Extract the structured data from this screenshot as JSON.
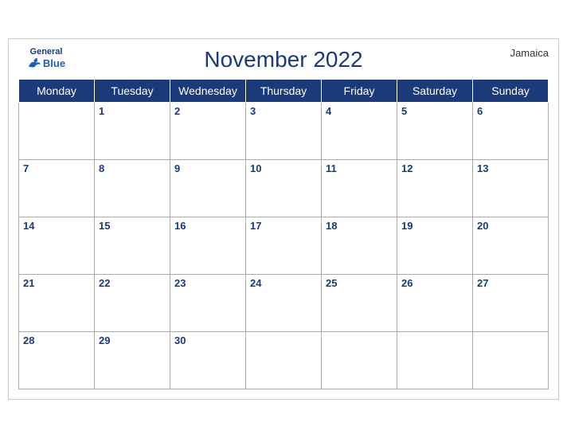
{
  "header": {
    "brand_general": "General",
    "brand_blue": "Blue",
    "title": "November 2022",
    "country": "Jamaica"
  },
  "days_of_week": [
    "Monday",
    "Tuesday",
    "Wednesday",
    "Thursday",
    "Friday",
    "Saturday",
    "Sunday"
  ],
  "weeks": [
    {
      "days": [
        null,
        1,
        2,
        3,
        4,
        5,
        6
      ]
    },
    {
      "days": [
        7,
        8,
        9,
        10,
        11,
        12,
        13
      ]
    },
    {
      "days": [
        14,
        15,
        16,
        17,
        18,
        19,
        20
      ]
    },
    {
      "days": [
        21,
        22,
        23,
        24,
        25,
        26,
        27
      ]
    },
    {
      "days": [
        28,
        29,
        30,
        null,
        null,
        null,
        null
      ]
    }
  ],
  "colors": {
    "header_bg": "#1a3a7a",
    "accent_blue": "#1a5fbf",
    "row_num_bg": "#1a5fbf",
    "title_color": "#1a3a7a"
  }
}
